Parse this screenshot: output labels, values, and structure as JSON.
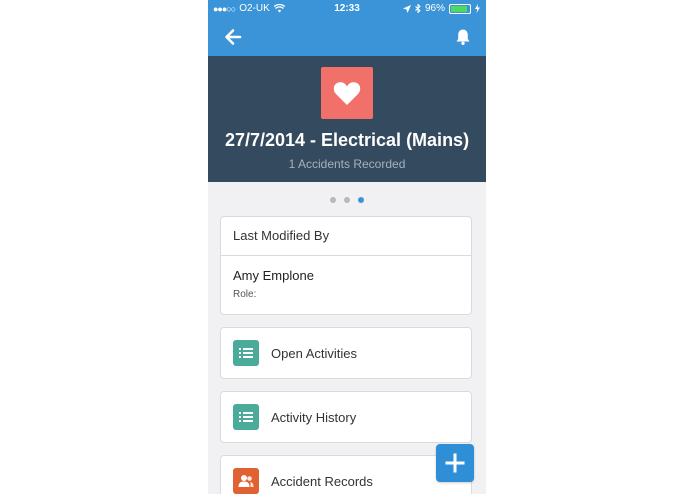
{
  "status_bar": {
    "signal_dots": "●●●○○",
    "carrier": "O2-UK",
    "time": "12:33",
    "battery_percent": "96%",
    "battery_level": 0.96
  },
  "nav": {
    "back_icon": "arrow-left-icon",
    "notification_icon": "bell-icon"
  },
  "header": {
    "icon": "heart-icon",
    "icon_color": "#f2706a",
    "title": "27/7/2014 - Electrical (Mains)",
    "subtitle": "1 Accidents Recorded"
  },
  "pager": {
    "total": 3,
    "active_index": 2
  },
  "last_modified": {
    "heading": "Last Modified By",
    "name": "Amy Emplone",
    "role_label": "Role:"
  },
  "related": [
    {
      "label": "Open Activities",
      "icon": "list-icon",
      "color": "#4bab9a"
    },
    {
      "label": "Activity History",
      "icon": "list-icon",
      "color": "#4bab9a"
    },
    {
      "label": "Accident Records",
      "icon": "people-icon",
      "color": "#e06232"
    }
  ],
  "colors": {
    "brand": "#3c94d8",
    "header_bg": "#344a5e"
  },
  "fab": {
    "icon": "plus-icon"
  }
}
